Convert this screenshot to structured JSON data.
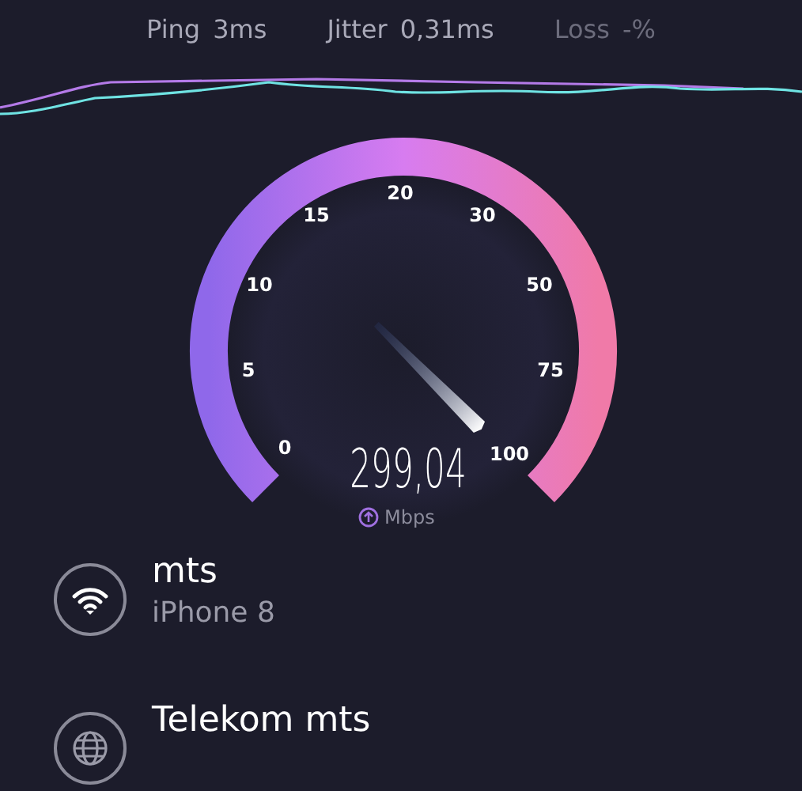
{
  "stats": [
    {
      "label": "Ping",
      "value": "3ms",
      "dim": false
    },
    {
      "label": "Jitter",
      "value": "0,31ms",
      "dim": false
    },
    {
      "label": "Loss",
      "value": "-%",
      "dim": true
    }
  ],
  "gauge": {
    "ticks": [
      "0",
      "5",
      "10",
      "15",
      "20",
      "30",
      "50",
      "75",
      "100"
    ],
    "value": "299,04",
    "unit": "Mbps"
  },
  "networks": [
    {
      "kind": "wifi",
      "name": "mts",
      "detail": "iPhone 8"
    },
    {
      "kind": "globe",
      "name": "Telekom mts"
    }
  ]
}
